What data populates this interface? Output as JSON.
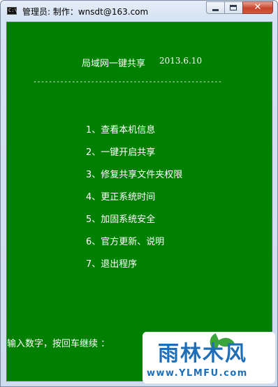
{
  "window": {
    "title": "管理员:  制作：wnsdt@163.com",
    "icon": "console-icon",
    "icon_text": "C:\\",
    "buttons": [
      "minimize-icon",
      "maximize-icon",
      "close-icon"
    ]
  },
  "console": {
    "background": "#008000",
    "text_color": "#ffffff",
    "heading": "局域网一键共享",
    "date": "2013.6.10",
    "divider": "-------------------------------------------------",
    "menu": [
      "1、查看本机信息",
      "2、一键开启共享",
      "3、修复共享文件夹权限",
      "4、更正系统时间",
      "5、加固系统安全",
      "6、官方更新、说明",
      "7、退出程序"
    ],
    "prompt": "输入数字，按回车继续 ："
  },
  "watermark": {
    "logo_text": "雨林木风",
    "url": "www.YLMFU.com",
    "color": "#1f6fb8"
  }
}
